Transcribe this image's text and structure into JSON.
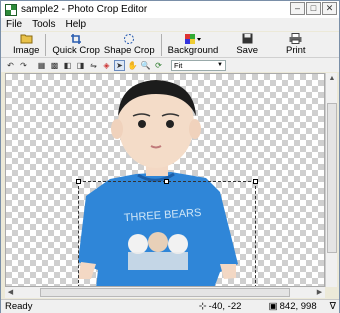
{
  "window": {
    "title": "sample2 - Photo Crop Editor"
  },
  "menu": [
    "File",
    "Tools",
    "Help"
  ],
  "toolbar": {
    "image": "Image",
    "quick_crop": "Quick Crop",
    "shape_crop": "Shape Crop",
    "background": "Background",
    "save": "Save",
    "print": "Print"
  },
  "zoom": {
    "value": "Fit"
  },
  "status": {
    "text": "Ready",
    "position": "-40, -22",
    "size": "842, 998"
  }
}
